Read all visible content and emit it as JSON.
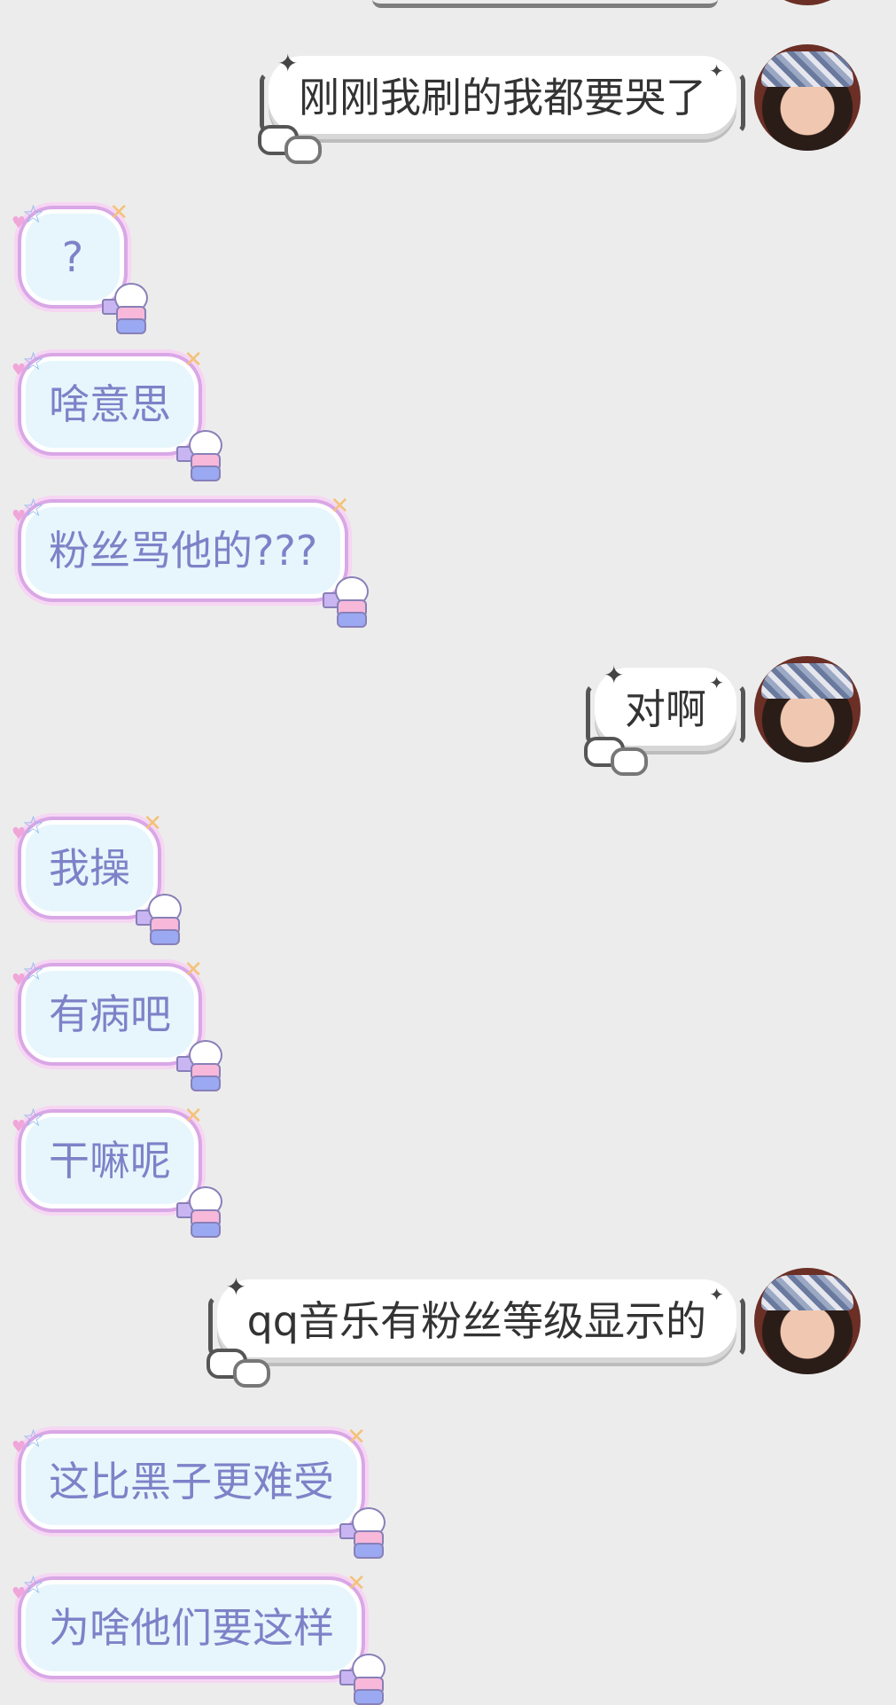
{
  "messages": [
    {
      "side": "right",
      "text": "刚刚我刷的我都要哭了"
    },
    {
      "side": "left",
      "text": "?"
    },
    {
      "side": "left",
      "text": "啥意思"
    },
    {
      "side": "left",
      "text": "粉丝骂他的???"
    },
    {
      "side": "right",
      "text": "对啊"
    },
    {
      "side": "left",
      "text": "我操"
    },
    {
      "side": "left",
      "text": "有病吧"
    },
    {
      "side": "left",
      "text": "干嘛呢"
    },
    {
      "side": "right",
      "text": "qq音乐有粉丝等级显示的"
    },
    {
      "side": "left",
      "text": "这比黑子更难受"
    },
    {
      "side": "left",
      "text": "为啥他们要这样"
    }
  ],
  "colors": {
    "background": "#ececec",
    "left_text": "#7d82c8",
    "left_fill": "#e6f6fc",
    "left_border": "#d9a7e6",
    "right_text": "#333333"
  }
}
